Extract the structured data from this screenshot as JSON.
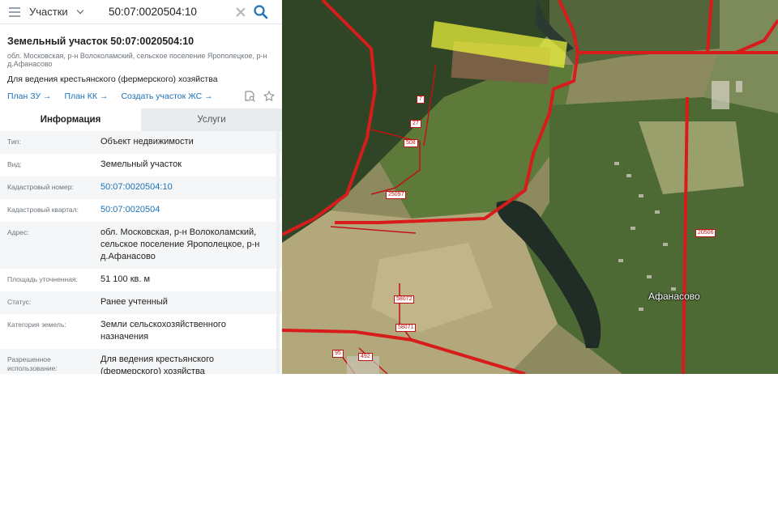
{
  "search": {
    "layer_label": "Участки",
    "query": "50:07:0020504:10"
  },
  "card": {
    "title": "Земельный участок 50:07:0020504:10",
    "address_line": "обл. Московская, р-н Волоколамский, сельское поселение Ярополецкое, р-н д.Афанасово",
    "purpose": "Для ведения крестьянского (фермерского) хозяйства",
    "links": [
      "План ЗУ →",
      "План КК →",
      "Создать участок ЖС →"
    ],
    "tabs": [
      "Информация",
      "Услуги"
    ],
    "rows": [
      {
        "label": "Тип:",
        "value": "Объект недвижимости",
        "link": false
      },
      {
        "label": "Вид:",
        "value": "Земельный участок",
        "link": false
      },
      {
        "label": "Кадастровый номер:",
        "value": "50:07:0020504:10",
        "link": true
      },
      {
        "label": "Кадастровый квартал:",
        "value": "50:07:0020504",
        "link": true
      },
      {
        "label": "Адрес:",
        "value": "обл. Московская, р-н Волоколамский, сельское поселение Ярополецкое, р-н д.Афанасово",
        "link": false
      },
      {
        "label": "Площадь уточненная:",
        "value": "51 100 кв. м",
        "link": false
      },
      {
        "label": "Статус:",
        "value": "Ранее учтенный",
        "link": false
      },
      {
        "label": "Категория земель:",
        "value": "Земли сельскохозяйственного назначения",
        "link": false
      },
      {
        "label": "Разрешенное использование:",
        "value": "Для ведения крестьянского (фермерского) хозяйства",
        "link": false
      }
    ]
  },
  "map": {
    "settlement": "Афанасово",
    "parcel_labels": [
      "7",
      "27",
      "508",
      "25097",
      "20506",
      "58072",
      "58071",
      "95",
      "492"
    ]
  },
  "colors": {
    "accent": "#1d72b8",
    "boundary": "#d81c1c",
    "highlight": "#e8f03a"
  }
}
